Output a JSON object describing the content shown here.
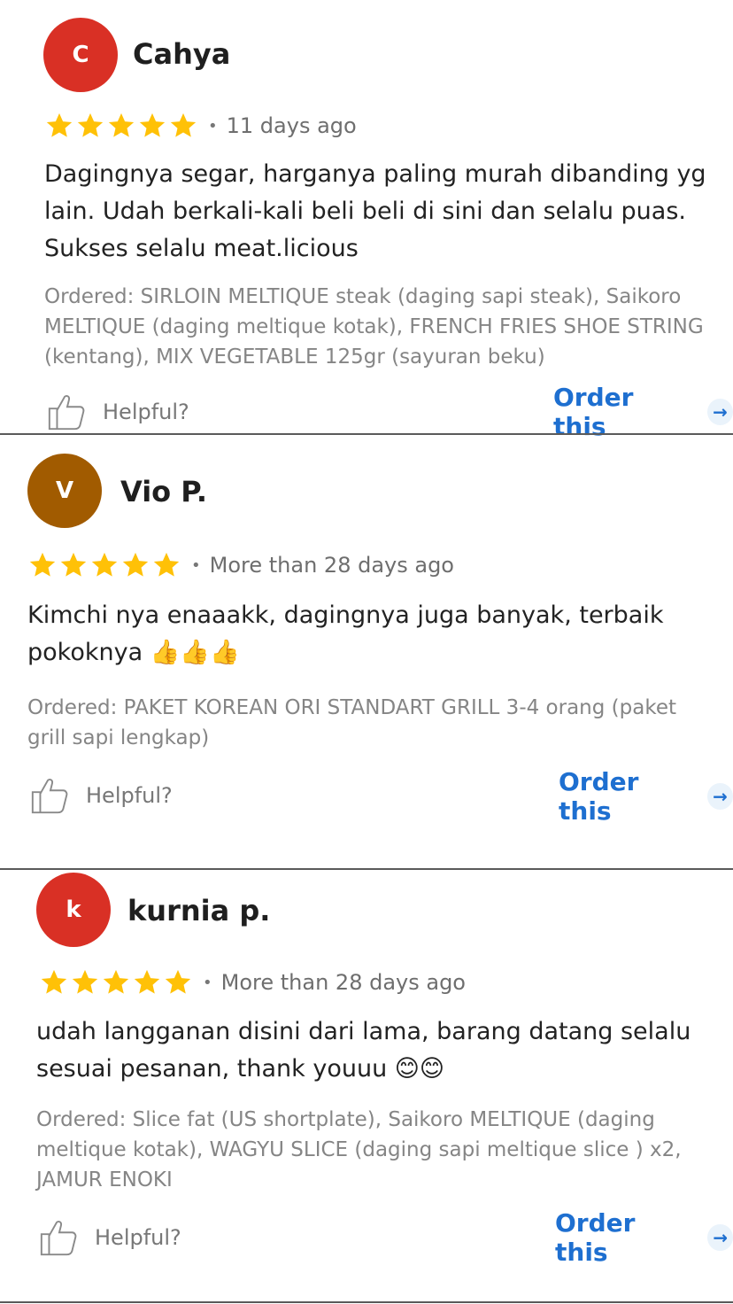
{
  "colors": {
    "star": "#FFC107",
    "link": "#1e6fd0",
    "divider": "#5a5a5a"
  },
  "reviews": [
    {
      "initial": "C",
      "avatar_color": "#d93025",
      "name": "Cahya",
      "rating": 5,
      "time": "11 days ago",
      "text": "Dagingnya segar, harganya paling murah dibanding yg lain. Udah berkali-kali beli  beli di sini dan selalu puas. Sukses selalu meat.licious",
      "ordered": "Ordered: SIRLOIN MELTIQUE steak (daging sapi steak), Saikoro MELTIQUE (daging meltique kotak), FRENCH FRIES SHOE STRING (kentang), MIX VEGETABLE 125gr (sayuran beku)",
      "helpful": "Helpful?",
      "order": "Order this"
    },
    {
      "initial": "V",
      "avatar_color": "#a15b00",
      "name": "Vio P.",
      "rating": 5,
      "time": "More than 28 days ago",
      "text": "Kimchi nya enaaakk, dagingnya juga banyak, terbaik pokoknya 👍👍👍",
      "ordered": "Ordered: PAKET KOREAN ORI STANDART GRILL 3-4 orang (paket grill sapi  lengkap)",
      "helpful": "Helpful?",
      "order": "Order this"
    },
    {
      "initial": "k",
      "avatar_color": "#d93025",
      "name": "kurnia p.",
      "rating": 5,
      "time": "More than 28 days ago",
      "text": "udah langganan disini dari lama, barang datang selalu sesuai pesanan, thank youuu 😊😊",
      "ordered": "Ordered: Slice fat (US shortplate), Saikoro MELTIQUE (daging meltique kotak), WAGYU SLICE (daging sapi meltique slice ) x2, JAMUR ENOKI",
      "helpful": "Helpful?",
      "order": "Order this"
    }
  ]
}
